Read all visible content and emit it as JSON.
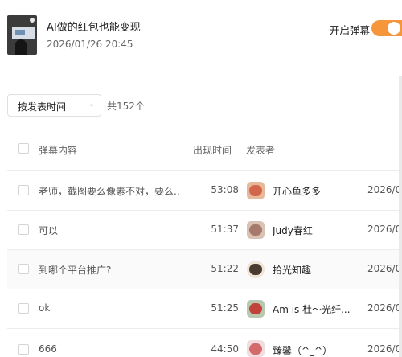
{
  "video": {
    "title": "AI做的红包也能变现",
    "published_time": "2026/01/26 20:45"
  },
  "danmaku_toggle": {
    "label": "开启弹幕",
    "on": true,
    "color": "#f5963a"
  },
  "filter": {
    "sort_label": "按发表时间",
    "total": "共152个"
  },
  "table": {
    "headers": {
      "content": "弹幕内容",
      "time": "出现时间",
      "author": "发表者"
    },
    "rows": [
      {
        "content": "老师，截图要么像素不对，要么...",
        "time": "53:08",
        "author": "开心鱼多多",
        "date": "2026/0",
        "avatar_color": "#e8b89a",
        "avatar_accent": "#d2664a"
      },
      {
        "content": "可以",
        "time": "51:37",
        "author": "Judy春红",
        "date": "2026/0",
        "avatar_color": "#d9c2b4",
        "avatar_accent": "#a57a6a"
      },
      {
        "content": "到哪个平台推广?",
        "time": "51:22",
        "author": "拾光知趣",
        "date": "2026/0",
        "avatar_color": "#efe4d6",
        "avatar_accent": "#4a3a30"
      },
      {
        "content": "ok",
        "time": "51:25",
        "author": "Am is 杜～光纤...",
        "date": "2026/0",
        "avatar_color": "#b8c9b0",
        "avatar_accent": "#c0423a"
      },
      {
        "content": "666",
        "time": "44:50",
        "author": "臻馨（^_^）",
        "date": "2026/0",
        "avatar_color": "#f0dede",
        "avatar_accent": "#d46a6a"
      }
    ]
  }
}
